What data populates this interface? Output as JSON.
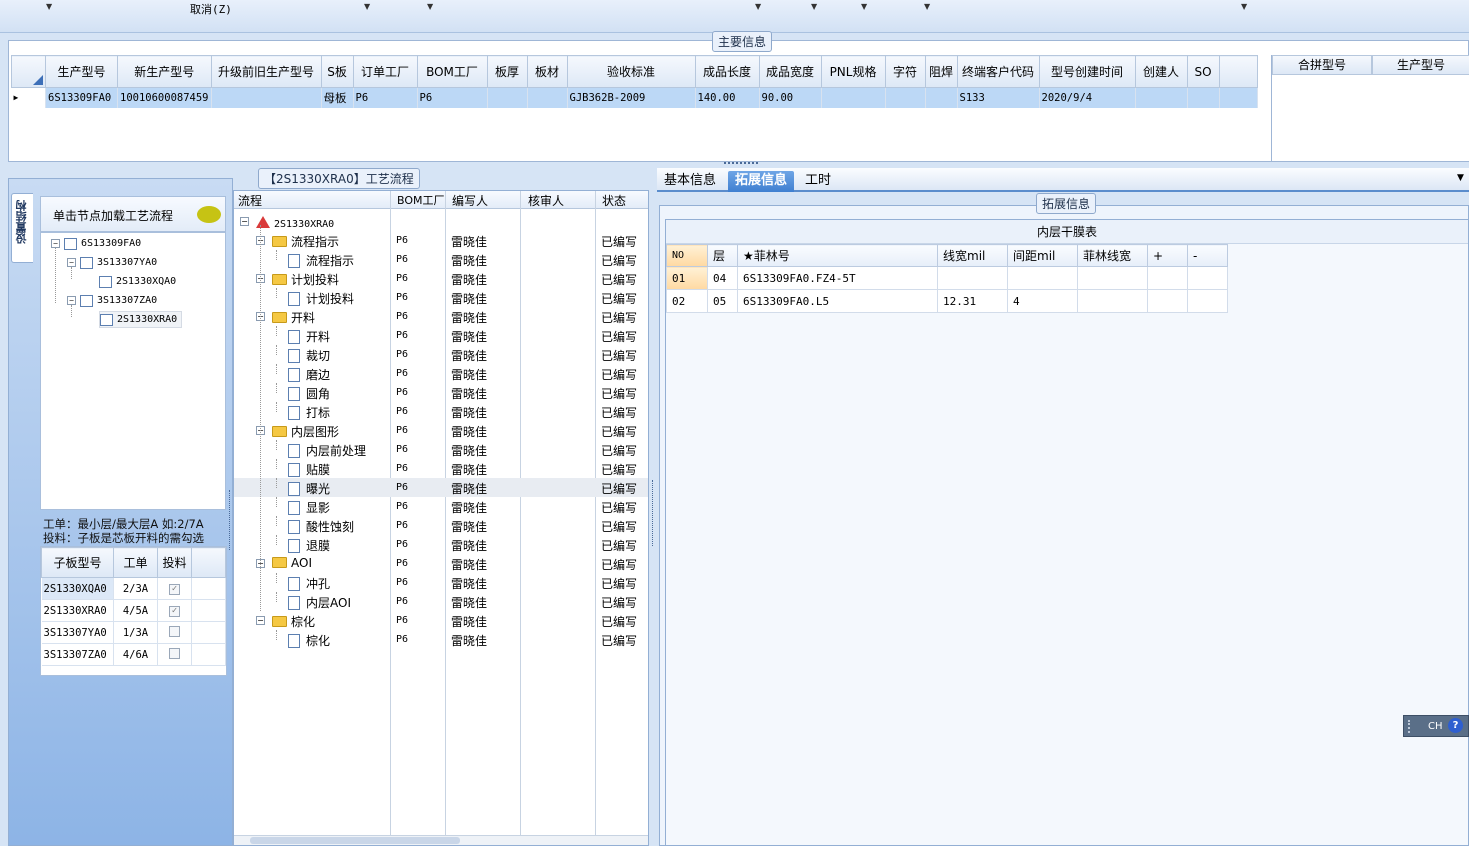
{
  "toolbar": {
    "cancel_label": "取消(Z)"
  },
  "main_info": {
    "title": "主要信息",
    "columns": [
      "生产型号",
      "新生产型号",
      "升级前旧生产型号",
      "S板",
      "订单工厂",
      "BOM工厂",
      "板厚",
      "板材",
      "验收标准",
      "成品长度",
      "成品宽度",
      "PNL规格",
      "字符",
      "阻焊",
      "终端客户代码",
      "型号创建时间",
      "创建人",
      "SO"
    ],
    "row": [
      "6S13309FA0",
      "10010600087459",
      "",
      "母板",
      "P6",
      "P6",
      "",
      "",
      "GJB362B-2009",
      "140.00",
      "90.00",
      "",
      "",
      "",
      "S133",
      "2020/9/4",
      "",
      ""
    ],
    "side_columns": [
      "合拼型号",
      "生产型号"
    ]
  },
  "left": {
    "vtab_label": "设置结构",
    "header": "单击节点加载工艺流程",
    "tree": [
      "6S13309FA0",
      "3S13307YA0",
      "2S1330XQA0",
      "3S13307ZA0",
      "2S1330XRA0"
    ],
    "hint_line1": "工单：最小层/最大层A 如:2/7A",
    "hint_line2": "投料：子板是芯板开料的需勾选",
    "sub_columns": [
      "子板型号",
      "工单",
      "投料"
    ],
    "sub_rows": [
      {
        "model": "2S1330XQA0",
        "wo": "2/3A",
        "checked": true
      },
      {
        "model": "2S1330XRA0",
        "wo": "4/5A",
        "checked": true
      },
      {
        "model": "3S13307YA0",
        "wo": "1/3A",
        "checked": false
      },
      {
        "model": "3S13307ZA0",
        "wo": "4/6A",
        "checked": false
      }
    ]
  },
  "process": {
    "title": "【2S1330XRA0】工艺流程",
    "columns": [
      "流程",
      "BOM工厂",
      "编写人",
      "核审人",
      "状态"
    ],
    "root": "2S1330XRA0",
    "rows": [
      {
        "name": "流程指示",
        "type": "folder",
        "factory": "P6",
        "writer": "雷晓佳",
        "status": "已编写"
      },
      {
        "name": "流程指示",
        "type": "doc",
        "factory": "P6",
        "writer": "雷晓佳",
        "status": "已编写"
      },
      {
        "name": "计划投料",
        "type": "folder",
        "factory": "P6",
        "writer": "雷晓佳",
        "status": "已编写"
      },
      {
        "name": "计划投料",
        "type": "doc",
        "factory": "P6",
        "writer": "雷晓佳",
        "status": "已编写"
      },
      {
        "name": "开料",
        "type": "folder",
        "factory": "P6",
        "writer": "雷晓佳",
        "status": "已编写"
      },
      {
        "name": "开料",
        "type": "doc",
        "factory": "P6",
        "writer": "雷晓佳",
        "status": "已编写"
      },
      {
        "name": "裁切",
        "type": "doc",
        "factory": "P6",
        "writer": "雷晓佳",
        "status": "已编写"
      },
      {
        "name": "磨边",
        "type": "doc",
        "factory": "P6",
        "writer": "雷晓佳",
        "status": "已编写"
      },
      {
        "name": "圆角",
        "type": "doc",
        "factory": "P6",
        "writer": "雷晓佳",
        "status": "已编写"
      },
      {
        "name": "打标",
        "type": "doc",
        "factory": "P6",
        "writer": "雷晓佳",
        "status": "已编写"
      },
      {
        "name": "内层图形",
        "type": "folder",
        "factory": "P6",
        "writer": "雷晓佳",
        "status": "已编写"
      },
      {
        "name": "内层前处理",
        "type": "doc",
        "factory": "P6",
        "writer": "雷晓佳",
        "status": "已编写"
      },
      {
        "name": "贴膜",
        "type": "doc",
        "factory": "P6",
        "writer": "雷晓佳",
        "status": "已编写"
      },
      {
        "name": "曝光",
        "type": "doc",
        "factory": "P6",
        "writer": "雷晓佳",
        "status": "已编写"
      },
      {
        "name": "显影",
        "type": "doc",
        "factory": "P6",
        "writer": "雷晓佳",
        "status": "已编写"
      },
      {
        "name": "酸性蚀刻",
        "type": "doc",
        "factory": "P6",
        "writer": "雷晓佳",
        "status": "已编写"
      },
      {
        "name": "退膜",
        "type": "doc",
        "factory": "P6",
        "writer": "雷晓佳",
        "status": "已编写"
      },
      {
        "name": "AOI",
        "type": "folder",
        "factory": "P6",
        "writer": "雷晓佳",
        "status": "已编写"
      },
      {
        "name": "冲孔",
        "type": "doc",
        "factory": "P6",
        "writer": "雷晓佳",
        "status": "已编写"
      },
      {
        "name": "内层AOI",
        "type": "doc",
        "factory": "P6",
        "writer": "雷晓佳",
        "status": "已编写"
      },
      {
        "name": "棕化",
        "type": "folder",
        "factory": "P6",
        "writer": "雷晓佳",
        "status": "已编写"
      },
      {
        "name": "棕化",
        "type": "doc",
        "factory": "P6",
        "writer": "雷晓佳",
        "status": "已编写"
      }
    ]
  },
  "tabs": [
    "基本信息",
    "拓展信息",
    "工时"
  ],
  "ext": {
    "title": "拓展信息",
    "table_title": "内层干膜表",
    "columns": [
      "NO",
      "层",
      "★菲林号",
      "线宽mil",
      "间距mil",
      "菲林线宽",
      "+",
      "-"
    ],
    "rows": [
      [
        "01",
        "04",
        "6S13309FA0.FZ4-5T",
        "",
        "",
        "",
        "",
        ""
      ],
      [
        "02",
        "05",
        "6S13309FA0.L5",
        "12.31",
        "4",
        "",
        "",
        ""
      ]
    ]
  },
  "ime": {
    "label": "CH",
    "help": "?"
  }
}
